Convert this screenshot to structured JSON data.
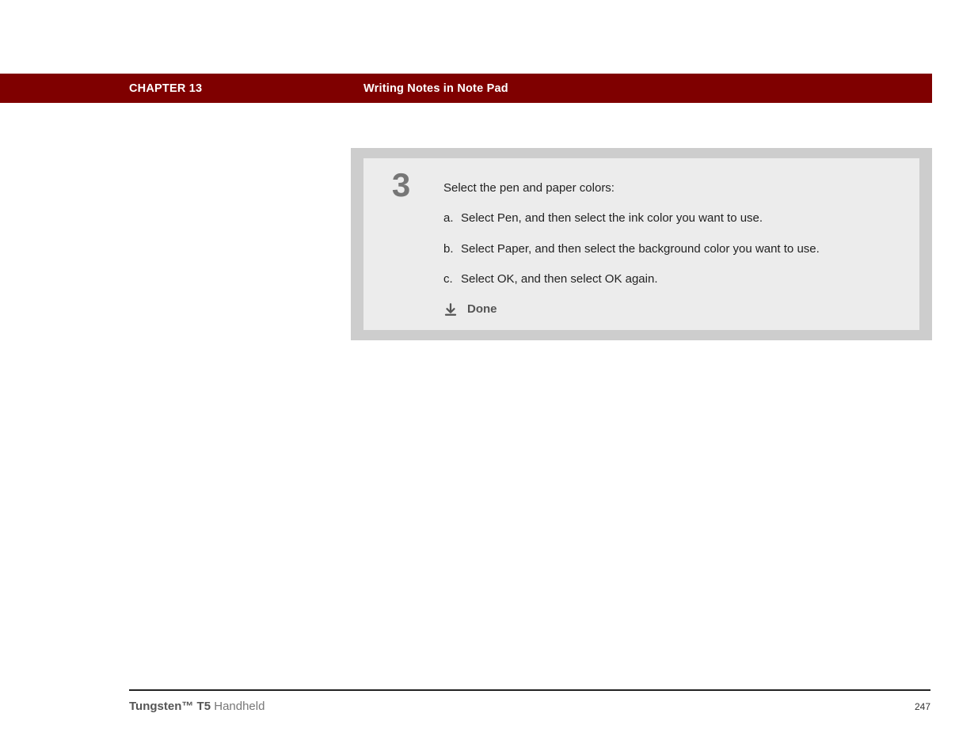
{
  "header": {
    "chapter": "CHAPTER 13",
    "section": "Writing Notes in Note Pad"
  },
  "step": {
    "number": "3",
    "intro": "Select the pen and paper colors:",
    "subs": [
      {
        "letter": "a.",
        "text": "Select Pen, and then select the ink color you want to use."
      },
      {
        "letter": "b.",
        "text": "Select Paper, and then select the background color you want to use."
      },
      {
        "letter": "c.",
        "text": "Select OK, and then select OK again."
      }
    ],
    "done_label": "Done"
  },
  "footer": {
    "product_strong": "Tungsten™ T5",
    "product_rest": " Handheld",
    "page_number": "247"
  }
}
